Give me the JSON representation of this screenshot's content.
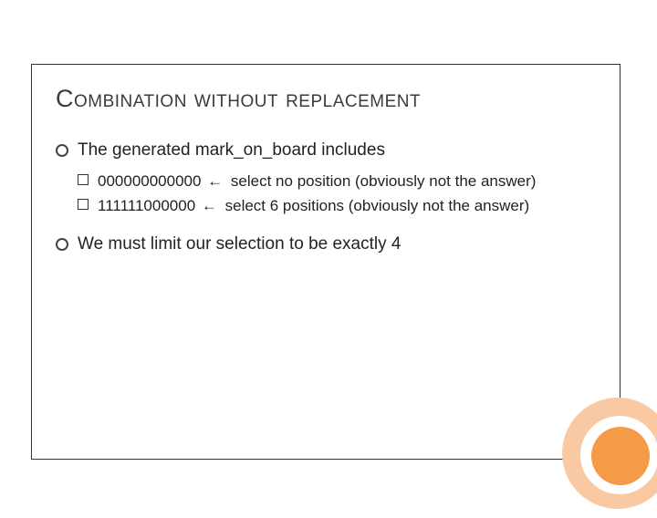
{
  "title": "Combination without replacement",
  "bullet1": "The generated mark_on_board includes",
  "sub1_prefix": "000000000000",
  "sub1_arrow": "←",
  "sub1_rest": " select no position (obviously not the answer)",
  "sub2_prefix": "111111000000",
  "sub2_arrow": "←",
  "sub2_rest": " select 6 positions (obviously not the answer)",
  "bullet2": "We must limit our selection to be exactly 4"
}
